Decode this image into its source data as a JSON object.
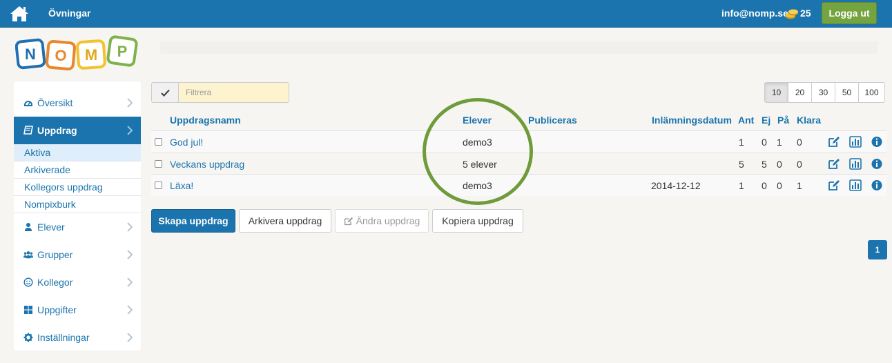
{
  "topbar": {
    "home_icon": "home-icon",
    "nav_label": "Övningar",
    "email": "info@nomp.se",
    "coins_icon": "coins-icon",
    "coins": "25",
    "logout_label": "Logga ut",
    "colors": {
      "bar": "#1b74ad",
      "logout": "#74a33f"
    }
  },
  "logo": {
    "letters": [
      "N",
      "O",
      "M",
      "P"
    ],
    "colors": [
      "#1f6fb2",
      "#e8872a",
      "#f2c230",
      "#7fb24a"
    ]
  },
  "sidebar": {
    "items": [
      {
        "label": "Översikt",
        "icon": "dashboard-icon",
        "active": false
      },
      {
        "label": "Uppdrag",
        "icon": "book-icon",
        "active": true
      },
      {
        "label": "Elever",
        "icon": "user-icon",
        "active": false
      },
      {
        "label": "Grupper",
        "icon": "users-icon",
        "active": false
      },
      {
        "label": "Kollegor",
        "icon": "smile-icon",
        "active": false
      },
      {
        "label": "Uppgifter",
        "icon": "grid-icon",
        "active": false
      },
      {
        "label": "Inställningar",
        "icon": "gear-icon",
        "active": false
      }
    ],
    "subitems": [
      {
        "label": "Aktiva",
        "active": true
      },
      {
        "label": "Arkiverade",
        "active": false
      },
      {
        "label": "Kollegors uppdrag",
        "active": false
      },
      {
        "label": "Nompixburk",
        "active": false
      }
    ]
  },
  "filter": {
    "placeholder": "Filtrera",
    "check_icon": "check-icon"
  },
  "pagesize": {
    "options": [
      "10",
      "20",
      "30",
      "50",
      "100"
    ],
    "selected": "10"
  },
  "table": {
    "headers": {
      "name": "Uppdragsnamn",
      "students": "Elever",
      "published": "Publiceras",
      "due": "Inlämningsdatum",
      "ant": "Ant",
      "ej": "Ej",
      "pa": "På",
      "klara": "Klara"
    },
    "rows": [
      {
        "name": "God jul!",
        "students": "demo3",
        "published": "",
        "due": "",
        "ant": "1",
        "ej": "0",
        "pa": "1",
        "klara": "0"
      },
      {
        "name": "Veckans uppdrag",
        "students": "5 elever",
        "published": "",
        "due": "",
        "ant": "5",
        "ej": "5",
        "pa": "0",
        "klara": "0"
      },
      {
        "name": "Läxa!",
        "students": "demo3",
        "published": "",
        "due": "2014-12-12",
        "ant": "1",
        "ej": "0",
        "pa": "0",
        "klara": "1"
      }
    ],
    "row_icons": [
      "edit-icon",
      "bar-chart-icon",
      "info-icon"
    ]
  },
  "actions": {
    "create": "Skapa uppdrag",
    "archive": "Arkivera uppdrag",
    "edit": "Ändra uppdrag",
    "edit_icon": "edit-icon",
    "copy": "Kopiera uppdrag"
  },
  "pagination": {
    "current": "1"
  },
  "annotation": {
    "color": "#6f9b3a"
  }
}
